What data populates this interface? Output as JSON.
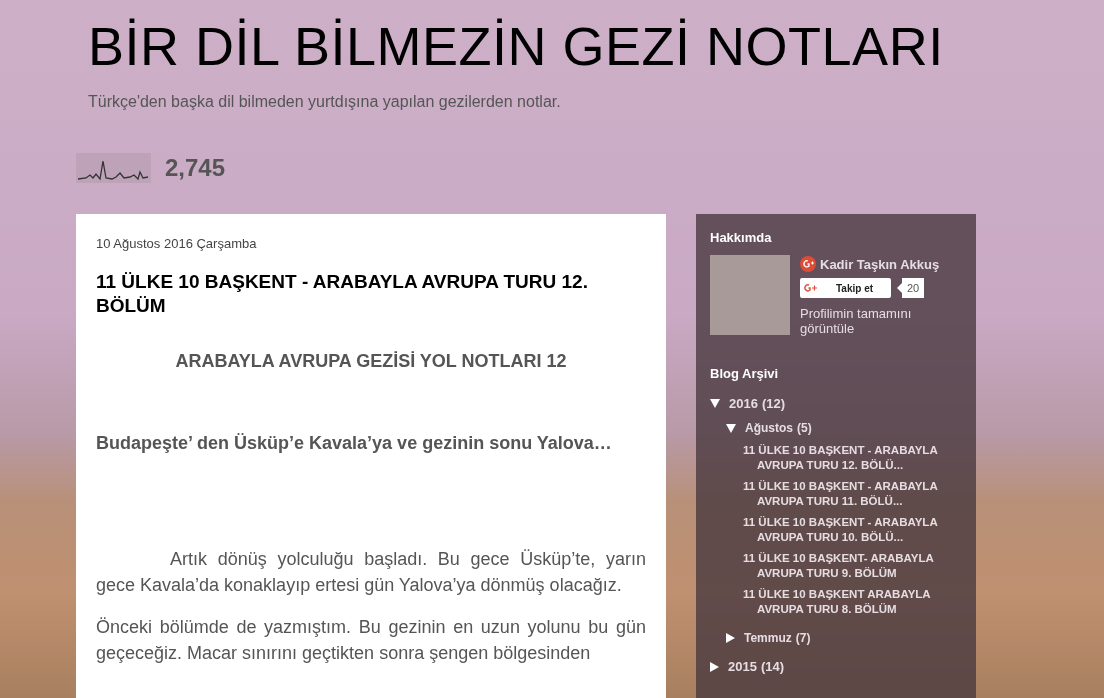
{
  "header": {
    "title": "BİR DİL BİLMEZİN GEZİ NOTLARI",
    "description": "Türkçe'den başka dil bilmeden yurtdışına yapılan gezilerden notlar."
  },
  "stats": {
    "count": "2,745"
  },
  "post": {
    "date": "10 Ağustos 2016 Çarşamba",
    "title": "11 ÜLKE 10 BAŞKENT - ARABAYLA AVRUPA TURU 12. BÖLÜM",
    "paragraphs": [
      {
        "kind": "heading",
        "text": "ARABAYLA AVRUPA  GEZİSİ YOL NOTLARI 12"
      },
      {
        "kind": "lead",
        "text": "Budapeşte’ den  Üsküp’e Kavala’ya ve gezinin sonu Yalova…"
      },
      {
        "kind": "indented",
        "text": "Artık dönüş yolculuğu başladı. Bu gece Üsküp’te, yarın gece Kavala’da konaklayıp  ertesi gün Yalova’ya dönmüş olacağız."
      },
      {
        "kind": "plain",
        "text": "Önceki bölümde de yazmıştım. Bu gezinin en uzun yolunu bu gün geçeceğiz. Macar sınırını geçtikten sonra şengen bölgesinden"
      }
    ]
  },
  "sidebar": {
    "about": {
      "heading": "Hakkımda",
      "name": "Kadir Taşkın Akkuş",
      "follow_label": "Takip et",
      "follower_count": "20",
      "profile_link": "Profilimin tamamını görüntüle"
    },
    "archive": {
      "heading": "Blog Arşivi",
      "years": [
        {
          "label": "2016",
          "count": "(12)",
          "expanded": true,
          "children": [
            {
              "label": "Ağustos",
              "count": "(5)",
              "expanded": true,
              "children": [
                {
                  "label": "11 ÜLKE 10 BAŞKENT - ARABAYLA AVRUPA TURU 12. BÖLÜ..."
                },
                {
                  "label": "11 ÜLKE 10 BAŞKENT - ARABAYLA AVRUPA TURU 11. BÖLÜ..."
                },
                {
                  "label": "11 ÜLKE 10 BAŞKENT - ARABAYLA AVRUPA TURU 10. BÖLÜ..."
                },
                {
                  "label": "11 ÜLKE 10 BAŞKENT- ARABAYLA AVRUPA TURU 9. BÖLÜM"
                },
                {
                  "label": "11 ÜLKE 10 BAŞKENT ARABAYLA AVRUPA TURU 8. BÖLÜM"
                }
              ]
            },
            {
              "label": "Temmuz",
              "count": "(7)",
              "expanded": false
            }
          ]
        },
        {
          "label": "2015",
          "count": "(14)",
          "expanded": false
        }
      ]
    }
  }
}
